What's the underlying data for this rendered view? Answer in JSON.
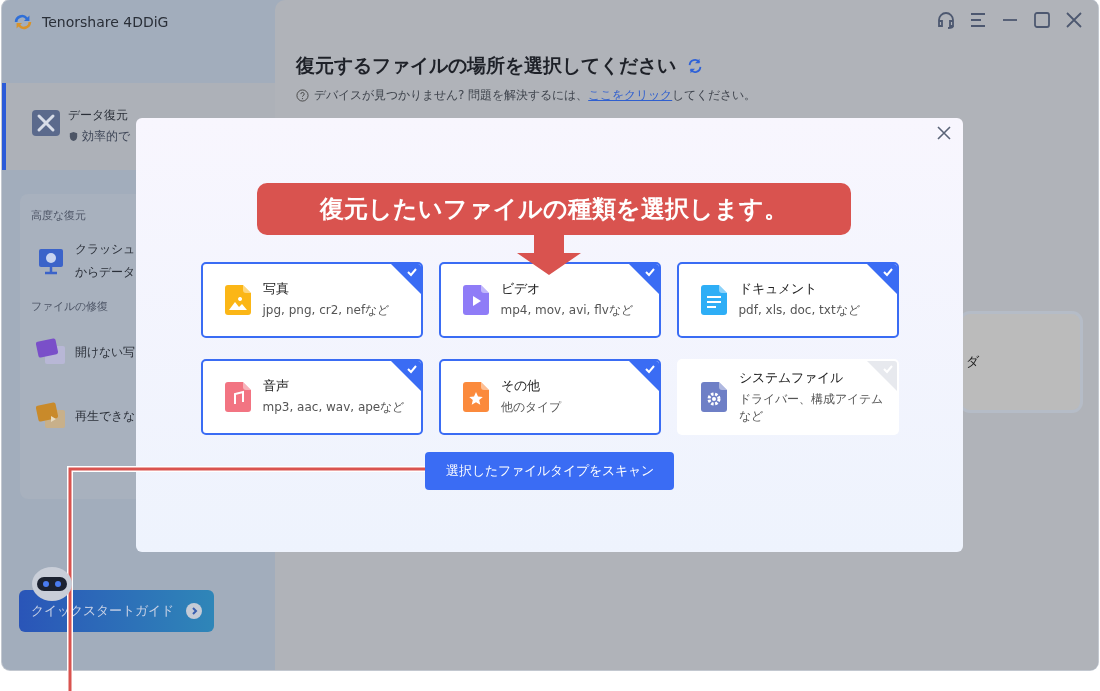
{
  "app": {
    "title": "Tenorshare 4DDiG"
  },
  "sidebar": {
    "items": [
      {
        "title": "データ復元",
        "subtitle": "効率的で",
        "selected": true
      }
    ],
    "sections": [
      {
        "heading": "高度な復元",
        "items": [
          {
            "kind": "crash",
            "lines": [
              "クラッシュ",
              "からデータ"
            ],
            "selected": false
          }
        ]
      },
      {
        "heading": "ファイルの修復",
        "items": [
          {
            "kind": "photo",
            "lines": [
              "開けない写"
            ],
            "selected": false
          },
          {
            "kind": "video",
            "lines": [
              "再生できな"
            ],
            "selected": false
          }
        ]
      }
    ],
    "quick_start": "クイックスタートガイド"
  },
  "main": {
    "title": "復元するファイルの場所を選択してください",
    "help": {
      "before": "デバイスが見つかりません? 問題を解決するには、",
      "link": "ここをクリック",
      "after": "してください。"
    },
    "background_card": "ダ"
  },
  "dialog": {
    "cards": [
      {
        "kind": "image",
        "name": "写真",
        "desc": "jpg, png, cr2, nefなど",
        "selected": true
      },
      {
        "kind": "video",
        "name": "ビデオ",
        "desc": "mp4, mov, avi, flvなど",
        "selected": true
      },
      {
        "kind": "document",
        "name": "ドキュメント",
        "desc": "pdf, xls, doc, txtなど",
        "selected": true
      },
      {
        "kind": "audio",
        "name": "音声",
        "desc": "mp3, aac, wav, apeなど",
        "selected": true
      },
      {
        "kind": "other",
        "name": "その他",
        "desc": "他のタイプ",
        "selected": true
      },
      {
        "kind": "system",
        "name": "システムファイル",
        "desc": "ドライバー、構成アイテムなど",
        "selected": false
      }
    ],
    "scan_button": "選択したファイルタイプをスキャン"
  },
  "callout": {
    "text": "復元したいファイルの種類を選択します。"
  }
}
